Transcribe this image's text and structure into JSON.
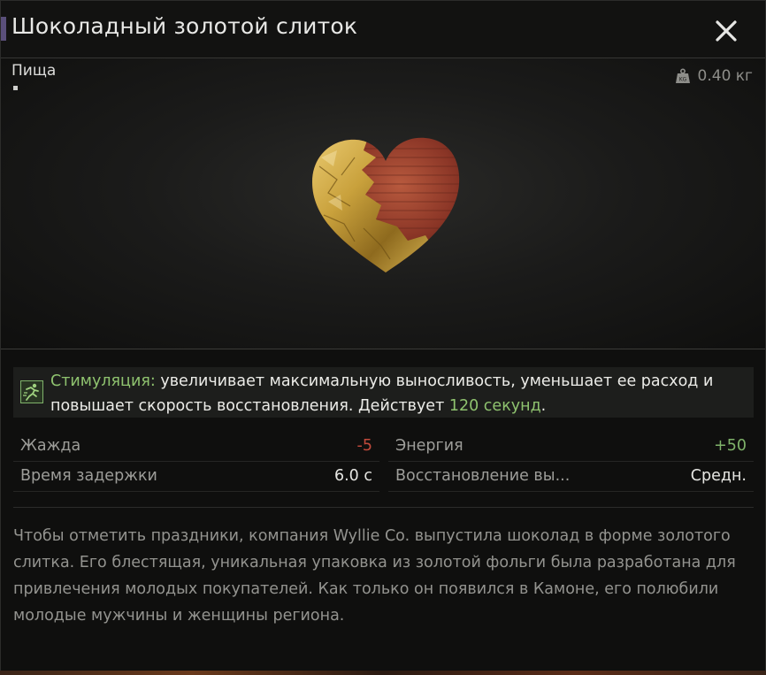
{
  "window": {
    "title": "Шоколадный золотой слиток",
    "close_icon": "close-icon"
  },
  "item": {
    "category": "Пища",
    "weight": "0.40 кг",
    "weight_icon": "weight-icon"
  },
  "effect": {
    "icon": "running-person-icon",
    "name": "Стимуляция:",
    "text_part1": " увеличивает максимальную выносливость, уменьшает ее расход и повышает скорость восстановления. Действует ",
    "duration": "120 секунд",
    "text_part2": ".",
    "highlight_color": "#8fc36f"
  },
  "stats": [
    {
      "label": "Жажда",
      "value": "-5",
      "tone": "negative"
    },
    {
      "label": "Энергия",
      "value": "+50",
      "tone": "positive"
    },
    {
      "label": "Время задержки",
      "value": "6.0 с",
      "tone": "neutral"
    },
    {
      "label": "Восстановление вы...",
      "value": "Средн.",
      "tone": "neutral"
    }
  ],
  "description": "Чтобы отметить праздники, компания Wyllie Co. выпустила шоколад в форме золотого слитка. Его блестящая, уникальная упаковка из золотой фольги была разработана для привлечения молодых покупателей. Как только он появился в Камоне, его полюбили молодые мужчины и женщины региона.",
  "colors": {
    "negative": "#c24a3c",
    "positive": "#7fb36a",
    "accent": "#5a4f7a"
  }
}
